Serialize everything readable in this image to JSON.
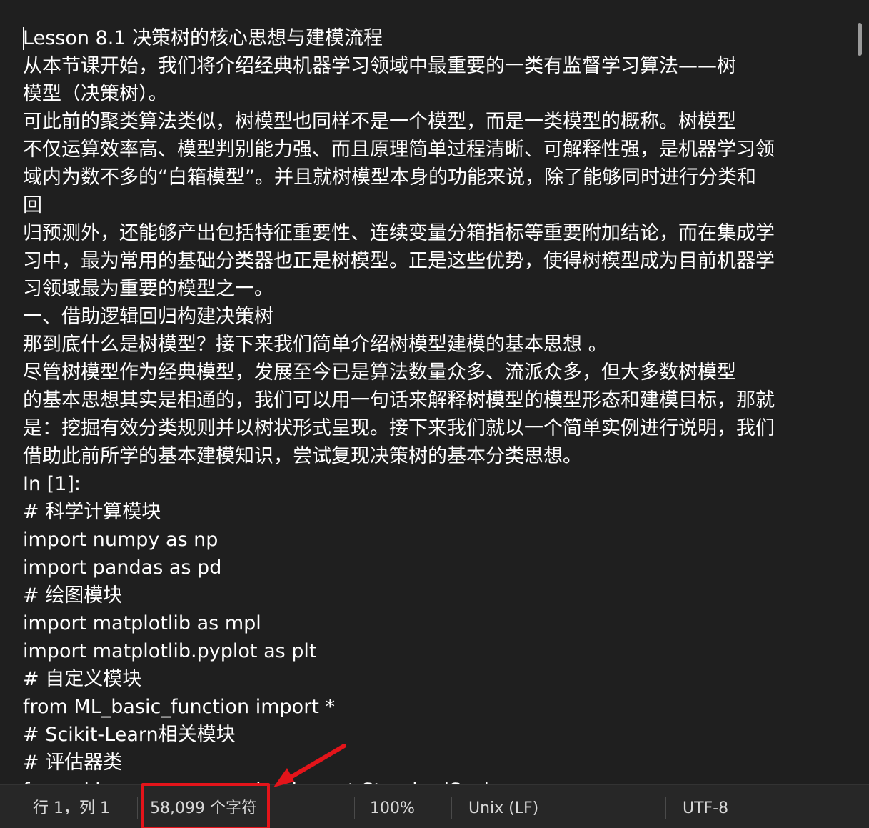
{
  "editor": {
    "lines": [
      "Lesson 8.1 决策树的核心思想与建模流程",
      "从本节课开始，我们将介绍经典机器学习领域中最重要的一类有监督学习算法——树",
      "模型（决策树）。",
      "可此前的聚类算法类似，树模型也同样不是一个模型，而是一类模型的概称。树模型",
      "不仅运算效率高、模型判别能力强、而且原理简单过程清晰、可解释性强，是机器学习领",
      "域内为数不多的“白箱模型”。并且就树模型本身的功能来说，除了能够同时进行分类和",
      "回",
      "归预测外，还能够产出包括特征重要性、连续变量分箱指标等重要附加结论，而在集成学",
      "习中，最为常用的基础分类器也正是树模型。正是这些优势，使得树模型成为目前机器学",
      "习领域最为重要的模型之一。",
      "一、借助逻辑回归构建决策树",
      "那到底什么是树模型？接下来我们简单介绍树模型建模的基本思想 。",
      "尽管树模型作为经典模型，发展至今已是算法数量众多、流派众多，但大多数树模型",
      "的基本思想其实是相通的，我们可以用一句话来解释树模型的模型形态和建模目标，那就",
      "是：挖掘有效分类规则并以树状形式呈现。接下来我们就以一个简单实例进行说明，我们",
      "借助此前所学的基本建模知识，尝试复现决策树的基本分类思想。",
      "In [1]:",
      "# 科学计算模块",
      "import numpy as np",
      "import pandas as pd",
      "# 绘图模块",
      "import matplotlib as mpl",
      "import matplotlib.pyplot as plt",
      "# 自定义模块",
      "from ML_basic_function import *",
      "# Scikit-Learn相关模块",
      "# 评估器类",
      "from sklearn.preprocessing import StandardScaler"
    ]
  },
  "statusbar": {
    "position": "行 1，列 1",
    "char_count": "58,099 个字符",
    "zoom": "100%",
    "line_ending": "Unix (LF)",
    "encoding": "UTF-8"
  },
  "colors": {
    "background": "#1f1f1f",
    "statusbar": "#272727",
    "text": "#ffffff",
    "annotation": "#e3141a"
  }
}
